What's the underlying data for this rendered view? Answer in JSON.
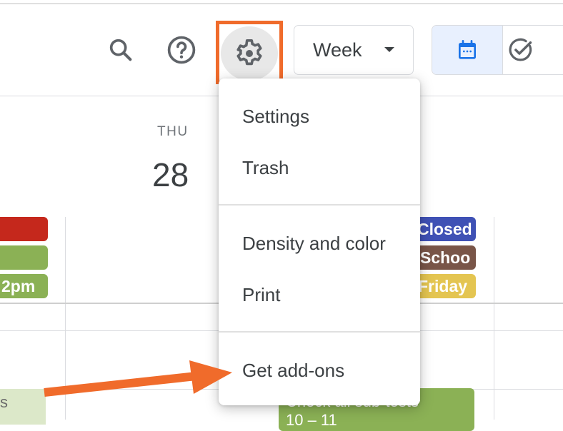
{
  "toolbar": {
    "search_icon": "search-icon",
    "help_icon": "help-icon",
    "settings_icon": "gear-icon",
    "view_selector": {
      "selected": "Week"
    },
    "view_toggle": [
      {
        "name": "calendar",
        "icon": "calendar-icon",
        "active": true
      },
      {
        "name": "tasks",
        "icon": "check-circle-icon",
        "active": false
      }
    ]
  },
  "day_header": {
    "day_name": "THU",
    "day_number": "28"
  },
  "all_day_events": {
    "left_column": [
      {
        "text": "",
        "color": "#c5281c"
      },
      {
        "text": "",
        "color": "#8bb155"
      },
      {
        "text": "2pm",
        "color": "#8bb155"
      }
    ],
    "right_column": [
      {
        "text": "Closed",
        "color": "#3f51b5"
      },
      {
        "text": "Schoo",
        "color": "#795548"
      },
      {
        "text": "Friday",
        "color": "#e4c551"
      }
    ]
  },
  "settings_menu": {
    "items": [
      {
        "label": "Settings"
      },
      {
        "label": "Trash"
      },
      {
        "label": "Density and color"
      },
      {
        "label": "Print"
      },
      {
        "label": "Get add-ons"
      }
    ]
  },
  "timed_events": [
    {
      "text": "s",
      "color": "#dce8c9",
      "text_color": "#6b6b6b"
    },
    {
      "text": "Check all sub-tests",
      "subtext": "10 – 11",
      "color": "#8bb155"
    }
  ],
  "annotation": {
    "highlight_color": "#f06b2b",
    "arrow_target": "Get add-ons"
  }
}
